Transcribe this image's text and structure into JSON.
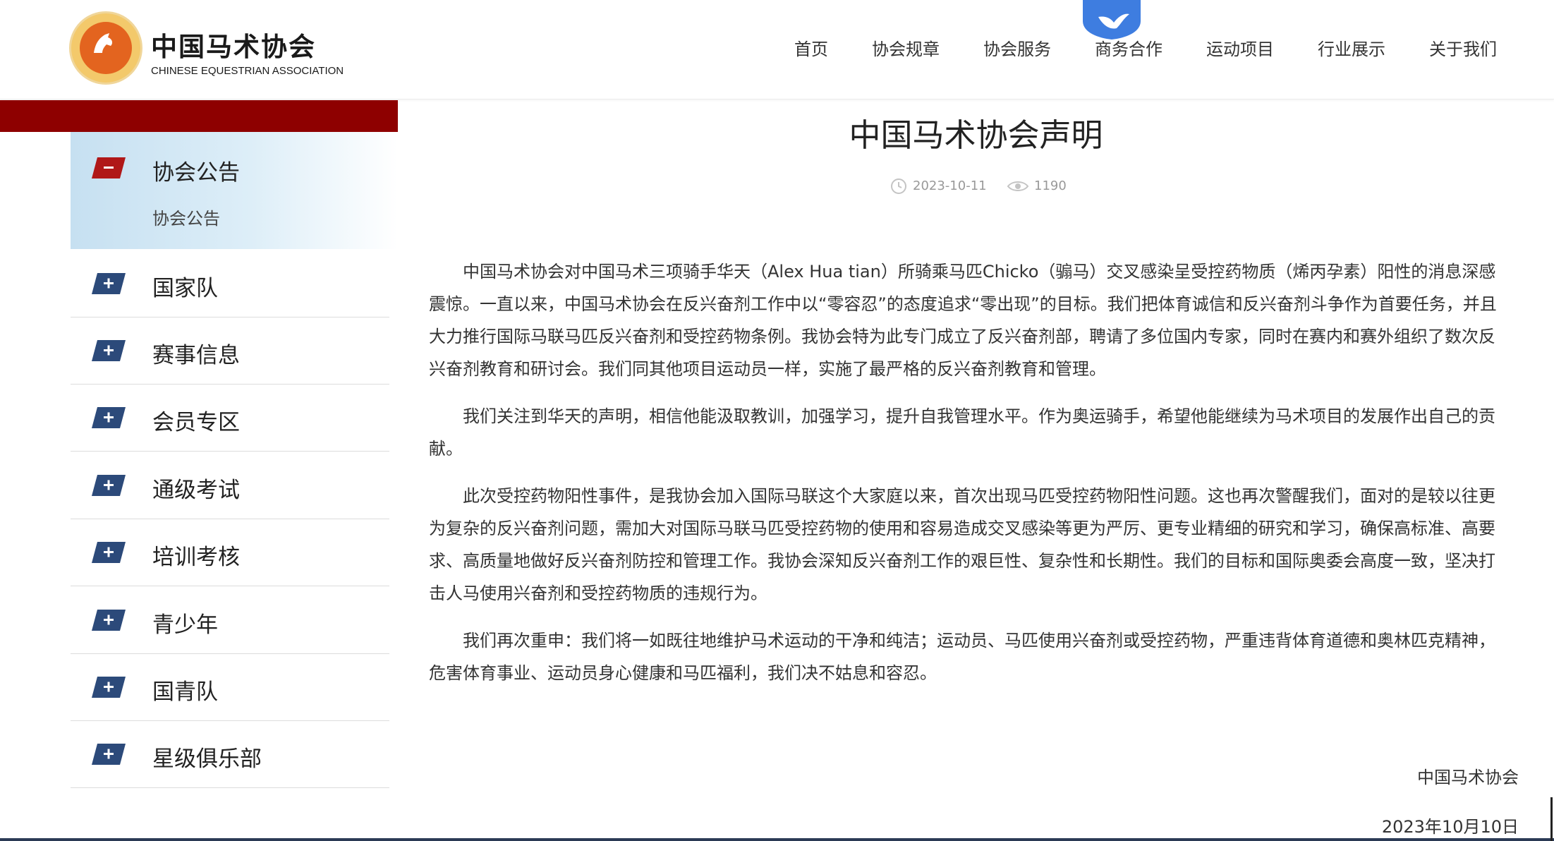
{
  "logo": {
    "name_cn": "中国马术协会",
    "name_en": "CHINESE EQUESTRIAN ASSOCIATION"
  },
  "nav": {
    "items": [
      {
        "label": "首页"
      },
      {
        "label": "协会规章"
      },
      {
        "label": "协会服务"
      },
      {
        "label": "商务合作"
      },
      {
        "label": "运动项目"
      },
      {
        "label": "行业展示"
      },
      {
        "label": "关于我们"
      }
    ]
  },
  "sidebar": {
    "active": {
      "label": "协会公告",
      "sub_label": "协会公告",
      "icon": "minus-icon"
    },
    "items": [
      {
        "label": "国家队",
        "icon": "plus-icon"
      },
      {
        "label": "赛事信息",
        "icon": "plus-icon"
      },
      {
        "label": "会员专区",
        "icon": "plus-icon"
      },
      {
        "label": "通级考试",
        "icon": "plus-icon"
      },
      {
        "label": "培训考核",
        "icon": "plus-icon"
      },
      {
        "label": "青少年",
        "icon": "plus-icon"
      },
      {
        "label": "国青队",
        "icon": "plus-icon"
      },
      {
        "label": "星级俱乐部",
        "icon": "plus-icon"
      }
    ]
  },
  "article": {
    "title": "中国马术协会声明",
    "date": "2023-10-11",
    "views": "1190",
    "paragraphs": [
      "中国马术协会对中国马术三项骑手华天（Alex Hua tian）所骑乘马匹Chicko（骟马）交叉感染呈受控药物质（烯丙孕素）阳性的消息深感震惊。一直以来，中国马术协会在反兴奋剂工作中以“零容忍”的态度追求“零出现”的目标。我们把体育诚信和反兴奋剂斗争作为首要任务，并且大力推行国际马联马匹反兴奋剂和受控药物条例。我协会特为此专门成立了反兴奋剂部，聘请了多位国内专家，同时在赛内和赛外组织了数次反兴奋剂教育和研讨会。我们同其他项目运动员一样，实施了最严格的反兴奋剂教育和管理。",
      "我们关注到华天的声明，相信他能汲取教训，加强学习，提升自我管理水平。作为奥运骑手，希望他能继续为马术项目的发展作出自己的贡献。",
      "此次受控药物阳性事件，是我协会加入国际马联这个大家庭以来，首次出现马匹受控药物阳性问题。这也再次警醒我们，面对的是较以往更为复杂的反兴奋剂问题，需加大对国际马联马匹受控药物的使用和容易造成交叉感染等更为严厉、更专业精细的研究和学习，确保高标准、高要求、高质量地做好反兴奋剂防控和管理工作。我协会深知反兴奋剂工作的艰巨性、复杂性和长期性。我们的目标和国际奥委会高度一致，坚决打击人马使用兴奋剂和受控药物质的违规行为。",
      "我们再次重申：我们将一如既往地维护马术运动的干净和纯洁；运动员、马匹使用兴奋剂或受控药物，严重违背体育道德和奥林匹克精神，危害体育事业、运动员身心健康和马匹福利，我们决不姑息和容忍。"
    ],
    "signature": "中国马术协会",
    "signed_date": "2023年10月10日"
  },
  "colors": {
    "sidebar_bar": "#8e0000",
    "icon_blue": "#2c4a7a",
    "icon_red": "#b01818"
  }
}
